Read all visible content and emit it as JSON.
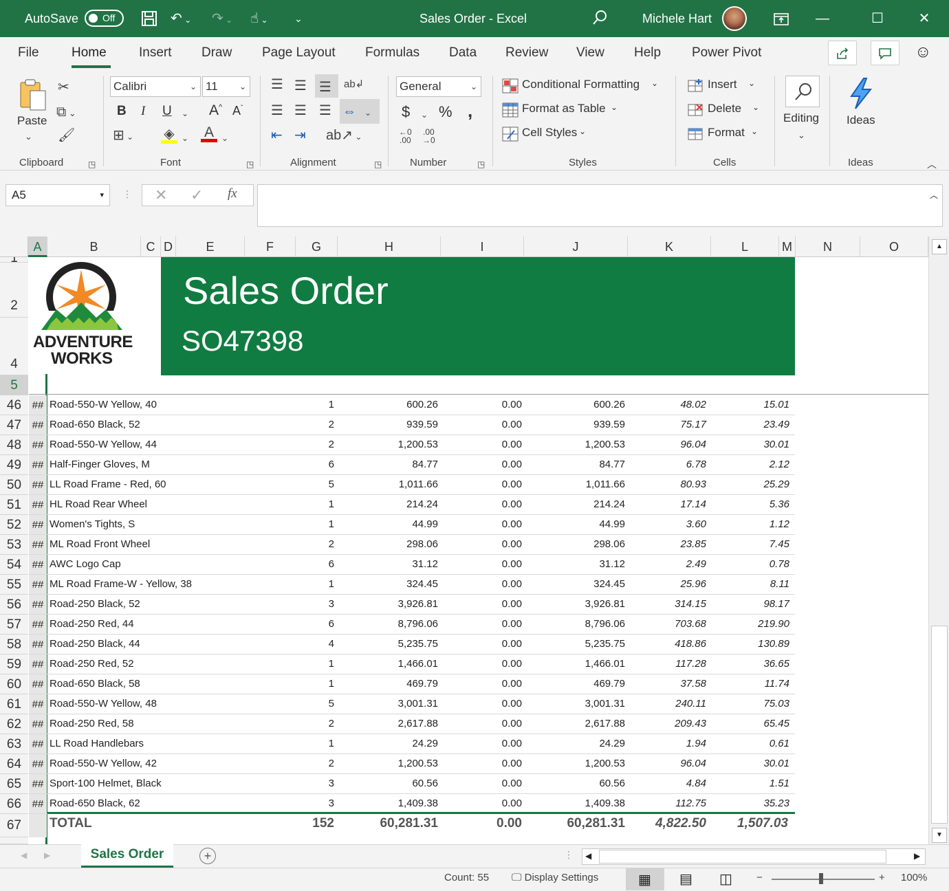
{
  "titlebar": {
    "autosave_label": "AutoSave",
    "autosave_state": "Off",
    "title": "Sales Order  -  Excel",
    "user_name": "Michele Hart"
  },
  "ribbon_tabs": [
    "File",
    "Home",
    "Insert",
    "Draw",
    "Page Layout",
    "Formulas",
    "Data",
    "Review",
    "View",
    "Help",
    "Power Pivot"
  ],
  "active_tab": "Home",
  "ribbon": {
    "clipboard": {
      "paste": "Paste",
      "label": "Clipboard"
    },
    "font": {
      "name": "Calibri",
      "size": "11",
      "bold": "B",
      "italic": "I",
      "underline": "U",
      "grow": "A",
      "shrink": "A",
      "label": "Font"
    },
    "alignment": {
      "label": "Alignment"
    },
    "number": {
      "format": "General",
      "currency": "$",
      "percent": "%",
      "comma": ",",
      "label": "Number"
    },
    "styles": {
      "conditional": "Conditional Formatting",
      "format_table": "Format as Table",
      "cell_styles": "Cell Styles",
      "label": "Styles"
    },
    "cells": {
      "insert": "Insert",
      "delete": "Delete",
      "format": "Format",
      "label": "Cells"
    },
    "editing": {
      "label": "Editing"
    },
    "ideas": {
      "button": "Ideas",
      "label": "Ideas"
    }
  },
  "formula_bar": {
    "name_box": "A5",
    "fx": "fx",
    "formula": ""
  },
  "columns": [
    "A",
    "B",
    "C",
    "D",
    "E",
    "F",
    "G",
    "H",
    "I",
    "J",
    "K",
    "L",
    "M",
    "N",
    "O"
  ],
  "banner": {
    "title": "Sales Order",
    "order_no": "SO47398",
    "logo_line1": "ADVENTURE",
    "logo_line2": "WORKS"
  },
  "header_rows": [
    "1",
    "2",
    "4",
    "5"
  ],
  "hash_text": "##",
  "rows": [
    {
      "row": "46",
      "product": "Road-550-W Yellow, 40",
      "qty": "1",
      "price": "600.26",
      "disc": "0.00",
      "total": "600.26",
      "tax": "48.02",
      "freight": "15.01"
    },
    {
      "row": "47",
      "product": "Road-650 Black, 52",
      "qty": "2",
      "price": "939.59",
      "disc": "0.00",
      "total": "939.59",
      "tax": "75.17",
      "freight": "23.49"
    },
    {
      "row": "48",
      "product": "Road-550-W Yellow, 44",
      "qty": "2",
      "price": "1,200.53",
      "disc": "0.00",
      "total": "1,200.53",
      "tax": "96.04",
      "freight": "30.01"
    },
    {
      "row": "49",
      "product": "Half-Finger Gloves, M",
      "qty": "6",
      "price": "84.77",
      "disc": "0.00",
      "total": "84.77",
      "tax": "6.78",
      "freight": "2.12"
    },
    {
      "row": "50",
      "product": "LL Road Frame - Red, 60",
      "qty": "5",
      "price": "1,011.66",
      "disc": "0.00",
      "total": "1,011.66",
      "tax": "80.93",
      "freight": "25.29"
    },
    {
      "row": "51",
      "product": "HL Road Rear Wheel",
      "qty": "1",
      "price": "214.24",
      "disc": "0.00",
      "total": "214.24",
      "tax": "17.14",
      "freight": "5.36"
    },
    {
      "row": "52",
      "product": "Women's Tights, S",
      "qty": "1",
      "price": "44.99",
      "disc": "0.00",
      "total": "44.99",
      "tax": "3.60",
      "freight": "1.12"
    },
    {
      "row": "53",
      "product": "ML Road Front Wheel",
      "qty": "2",
      "price": "298.06",
      "disc": "0.00",
      "total": "298.06",
      "tax": "23.85",
      "freight": "7.45"
    },
    {
      "row": "54",
      "product": "AWC Logo Cap",
      "qty": "6",
      "price": "31.12",
      "disc": "0.00",
      "total": "31.12",
      "tax": "2.49",
      "freight": "0.78"
    },
    {
      "row": "55",
      "product": "ML Road Frame-W - Yellow, 38",
      "qty": "1",
      "price": "324.45",
      "disc": "0.00",
      "total": "324.45",
      "tax": "25.96",
      "freight": "8.11"
    },
    {
      "row": "56",
      "product": "Road-250 Black, 52",
      "qty": "3",
      "price": "3,926.81",
      "disc": "0.00",
      "total": "3,926.81",
      "tax": "314.15",
      "freight": "98.17"
    },
    {
      "row": "57",
      "product": "Road-250 Red, 44",
      "qty": "6",
      "price": "8,796.06",
      "disc": "0.00",
      "total": "8,796.06",
      "tax": "703.68",
      "freight": "219.90"
    },
    {
      "row": "58",
      "product": "Road-250 Black, 44",
      "qty": "4",
      "price": "5,235.75",
      "disc": "0.00",
      "total": "5,235.75",
      "tax": "418.86",
      "freight": "130.89"
    },
    {
      "row": "59",
      "product": "Road-250 Red, 52",
      "qty": "1",
      "price": "1,466.01",
      "disc": "0.00",
      "total": "1,466.01",
      "tax": "117.28",
      "freight": "36.65"
    },
    {
      "row": "60",
      "product": "Road-650 Black, 58",
      "qty": "1",
      "price": "469.79",
      "disc": "0.00",
      "total": "469.79",
      "tax": "37.58",
      "freight": "11.74"
    },
    {
      "row": "61",
      "product": "Road-550-W Yellow, 48",
      "qty": "5",
      "price": "3,001.31",
      "disc": "0.00",
      "total": "3,001.31",
      "tax": "240.11",
      "freight": "75.03"
    },
    {
      "row": "62",
      "product": "Road-250 Red, 58",
      "qty": "2",
      "price": "2,617.88",
      "disc": "0.00",
      "total": "2,617.88",
      "tax": "209.43",
      "freight": "65.45"
    },
    {
      "row": "63",
      "product": "LL Road Handlebars",
      "qty": "1",
      "price": "24.29",
      "disc": "0.00",
      "total": "24.29",
      "tax": "1.94",
      "freight": "0.61"
    },
    {
      "row": "64",
      "product": "Road-550-W Yellow, 42",
      "qty": "2",
      "price": "1,200.53",
      "disc": "0.00",
      "total": "1,200.53",
      "tax": "96.04",
      "freight": "30.01"
    },
    {
      "row": "65",
      "product": "Sport-100 Helmet, Black",
      "qty": "3",
      "price": "60.56",
      "disc": "0.00",
      "total": "60.56",
      "tax": "4.84",
      "freight": "1.51"
    },
    {
      "row": "66",
      "product": "Road-650 Black, 62",
      "qty": "3",
      "price": "1,409.38",
      "disc": "0.00",
      "total": "1,409.38",
      "tax": "112.75",
      "freight": "35.23"
    }
  ],
  "total_row": {
    "row": "67",
    "label": "TOTAL",
    "qty": "152",
    "price": "60,281.31",
    "disc": "0.00",
    "total": "60,281.31",
    "tax": "4,822.50",
    "freight": "1,507.03"
  },
  "sheet_tab": "Sales Order",
  "status": {
    "count": "Count: 55",
    "display_settings": "Display Settings",
    "zoom": "100%"
  },
  "colors": {
    "excel_green": "#217346",
    "banner_green": "#107c41"
  }
}
